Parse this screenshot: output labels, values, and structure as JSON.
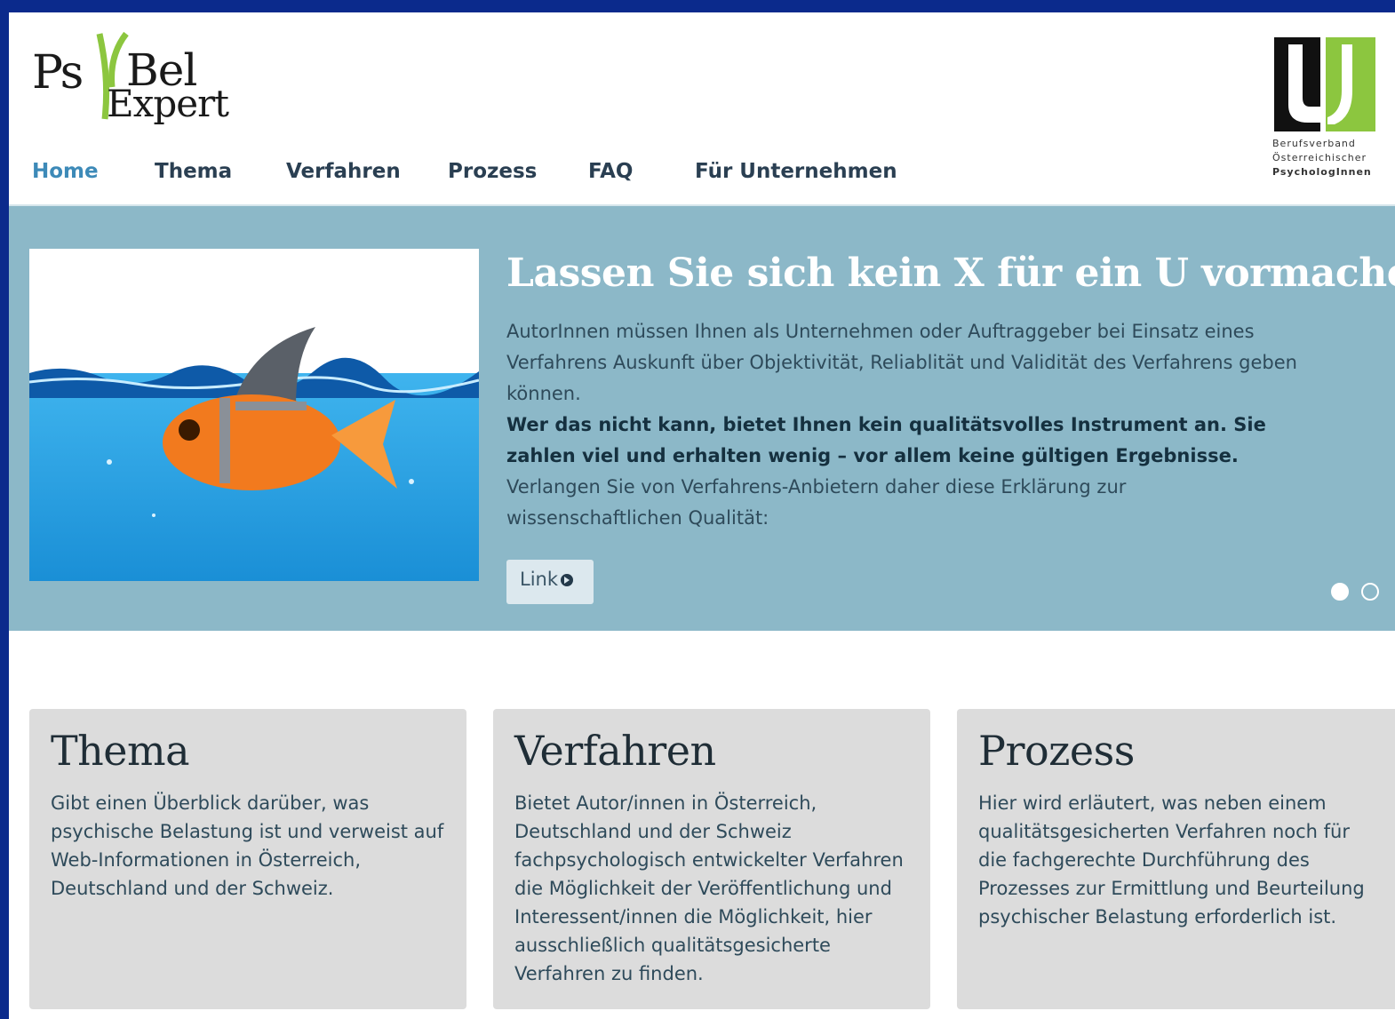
{
  "brand": {
    "logo_ps": "Ps",
    "logo_bel": "Bel",
    "logo_expert": "Expert",
    "assoc_line1": "Berufsverband",
    "assoc_line2": "Österreichischer",
    "assoc_line3": "PsychologInnen"
  },
  "nav": {
    "items": [
      {
        "label": "Home"
      },
      {
        "label": "Thema"
      },
      {
        "label": "Verfahren"
      },
      {
        "label": "Prozess"
      },
      {
        "label": "FAQ"
      },
      {
        "label": "Für Unternehmen"
      }
    ],
    "active_index": 0
  },
  "hero": {
    "title": "Lassen Sie sich kein X für ein U vormachen:",
    "paragraph1": "AutorInnen müssen Ihnen als Unternehmen oder Auftraggeber bei Einsatz eines Verfahrens Auskunft über Objektivität, Reliablität und Validität des Verfahrens geben können.",
    "paragraph2": "Wer das nicht kann, bietet Ihnen kein qualitätsvolles Instrument an. Sie zahlen viel und erhalten wenig – vor allem keine gültigen Ergebnisse.",
    "paragraph3": "Verlangen Sie von Verfahrens-Anbietern daher diese Erklärung zur wissenschaftlichen Qualität:",
    "link_label": "Link",
    "slides": 2,
    "active_slide": 1
  },
  "cards": [
    {
      "title": "Thema",
      "text": "Gibt einen Überblick darüber, was psychische Belastung ist und verweist auf Web-Informationen in Österreich, Deutschland und der Schweiz."
    },
    {
      "title": "Verfahren",
      "text": "Bietet Autor/innen in Österreich, Deutschland und der Schweiz fachpsychologisch entwickelter Verfahren die Möglichkeit der Veröffentlichung und Interessent/innen die Möglichkeit, hier ausschließlich qualitätsgesicherte Verfahren zu finden."
    },
    {
      "title": "Prozess",
      "text": "Hier wird erläutert, was neben einem qualitätsgesicherten Verfahren noch für die fachgerechte Durchführung des Prozesses zur Ermittlung und Beurteilung psychischer Belastung erforderlich ist."
    }
  ],
  "colors": {
    "frame": "#0b2a8c",
    "hero_bg": "#8cb8c8",
    "card_bg": "#dcdcdc",
    "nav_active": "#3d8ab8",
    "logo_green": "#8cc63f"
  }
}
